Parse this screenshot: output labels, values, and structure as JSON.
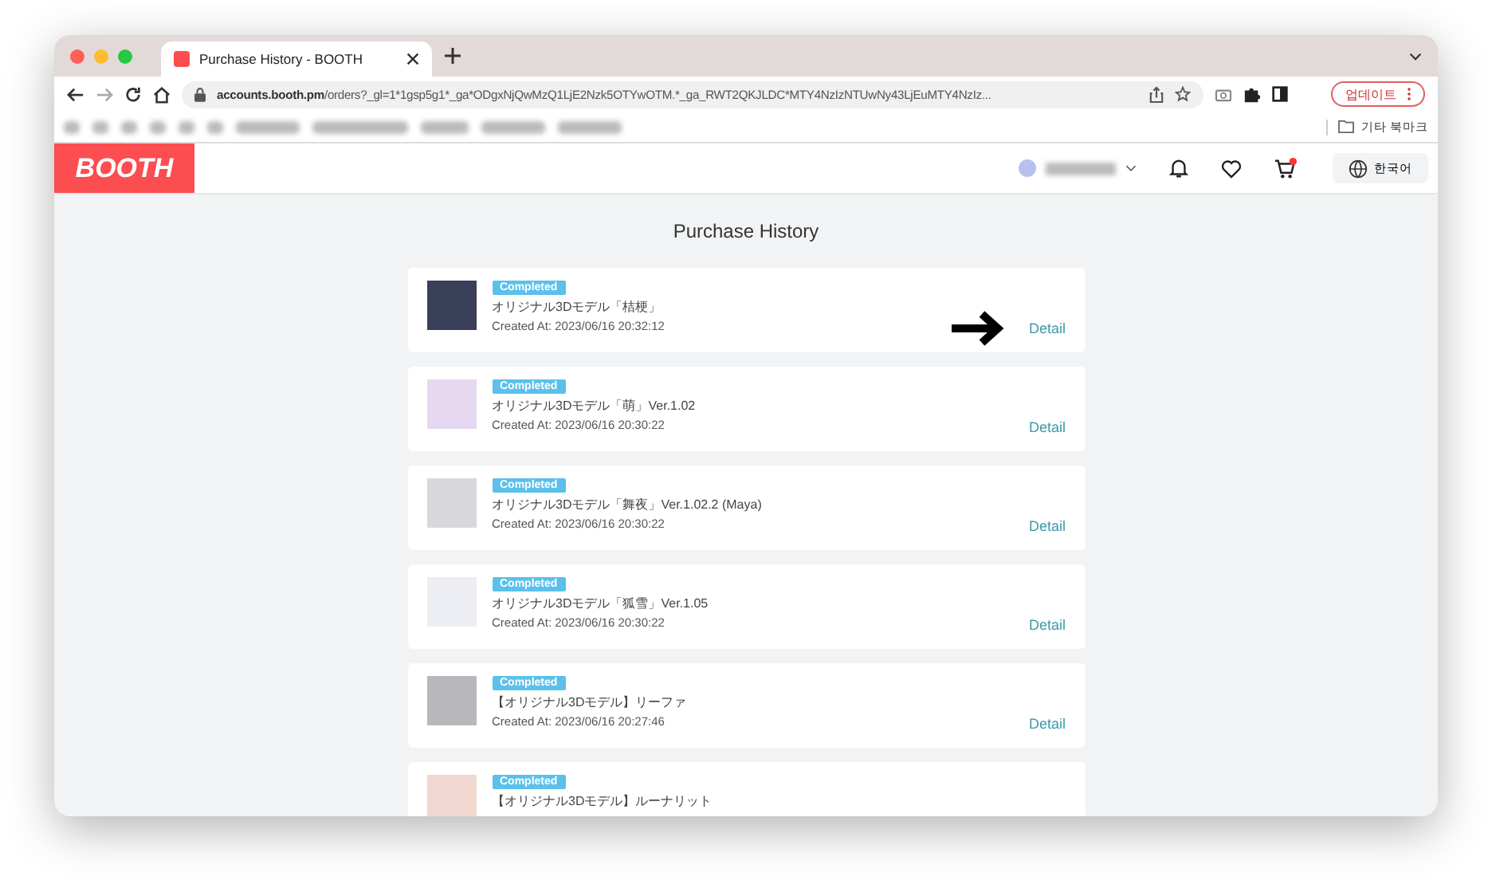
{
  "browser": {
    "tab_title": "Purchase History - BOOTH",
    "url_host": "accounts.booth.pm",
    "url_path": "/orders?_gl=1*1gsp5g1*_ga*ODgxNjQwMzQ1LjE2Nzk5OTYwOTM.*_ga_RWT2QKJLDC*MTY4NzIzNTUwNy43LjEuMTY4NzIz...",
    "update_button": "업데이트",
    "bookmarks_folder": "기타 북마크"
  },
  "header": {
    "logo": "BOOTH",
    "cart_has_badge": true,
    "language": "한국어"
  },
  "page": {
    "title": "Purchase History"
  },
  "orders": [
    {
      "status": "Completed",
      "name": "オリジナル3Dモデル「桔梗」",
      "created_at": "Created At: 2023/06/16 20:32:12",
      "link": "Detail",
      "arrow": true
    },
    {
      "status": "Completed",
      "name": "オリジナル3Dモデル「萌」Ver.1.02",
      "created_at": "Created At: 2023/06/16 20:30:22",
      "link": "Detail",
      "arrow": false
    },
    {
      "status": "Completed",
      "name": "オリジナル3Dモデル「舞夜」Ver.1.02.2 (Maya)",
      "created_at": "Created At: 2023/06/16 20:30:22",
      "link": "Detail",
      "arrow": false
    },
    {
      "status": "Completed",
      "name": "オリジナル3Dモデル「狐雪」Ver.1.05",
      "created_at": "Created At: 2023/06/16 20:30:22",
      "link": "Detail",
      "arrow": false
    },
    {
      "status": "Completed",
      "name": "【オリジナル3Dモデル】リーファ",
      "created_at": "Created At: 2023/06/16 20:27:46",
      "link": "Detail",
      "arrow": false
    },
    {
      "status": "Completed",
      "name": "【オリジナル3Dモデル】ルーナリット",
      "arrow": false
    }
  ]
}
